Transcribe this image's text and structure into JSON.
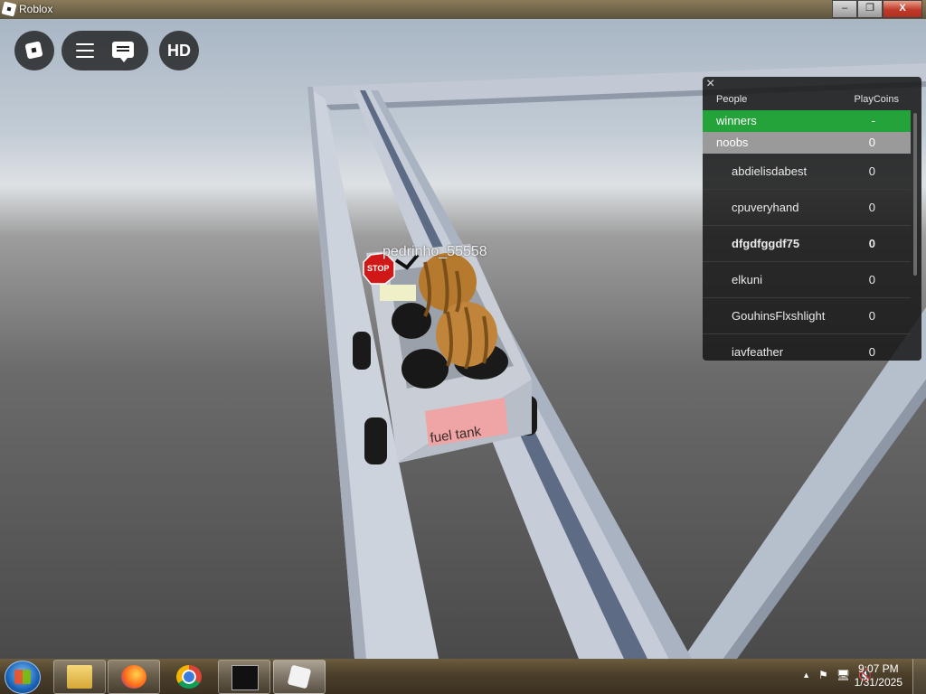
{
  "window": {
    "title": "Roblox",
    "min": "–",
    "max": "❐",
    "close": "X"
  },
  "game": {
    "player_name": "pedrinho_55558",
    "cart_sign": "STOP",
    "cart_label": "fuel tank"
  },
  "topbar": {
    "hd_label": "HD"
  },
  "leaderboard": {
    "close": "×",
    "col_people": "People",
    "col_stat": "PlayCoins",
    "teams": [
      {
        "name": "winners",
        "value": "-"
      },
      {
        "name": "noobs",
        "value": "0"
      }
    ],
    "players": [
      {
        "name": "abdielisdabest",
        "value": "0"
      },
      {
        "name": "cpuveryhand",
        "value": "0"
      },
      {
        "name": "dfgdfggdf75",
        "value": "0"
      },
      {
        "name": "elkuni",
        "value": "0"
      },
      {
        "name": "GouhinsFlxshlight",
        "value": "0"
      },
      {
        "name": "iavfeather",
        "value": "0"
      }
    ],
    "colors": {
      "winners": "#23a33a",
      "noobs": "#9a9a9a"
    }
  },
  "taskbar": {
    "time": "9:07 PM",
    "date": "1/31/2025",
    "tray_arrow": "▲",
    "apps": [
      "file-explorer",
      "firefox",
      "chrome",
      "command-prompt",
      "roblox"
    ]
  }
}
